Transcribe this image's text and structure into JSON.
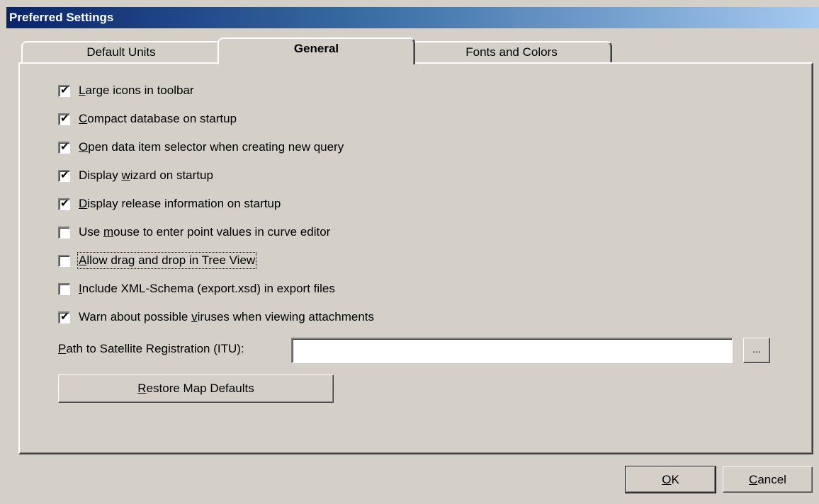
{
  "window": {
    "title": "Preferred Settings"
  },
  "tabs": [
    {
      "label": "Default Units",
      "active": false
    },
    {
      "label": "General",
      "active": true
    },
    {
      "label": "Fonts and Colors",
      "active": false
    }
  ],
  "options": [
    {
      "pre": "",
      "key": "L",
      "post": "arge icons in toolbar",
      "checked": true
    },
    {
      "pre": "",
      "key": "C",
      "post": "ompact database on startup",
      "checked": true
    },
    {
      "pre": "",
      "key": "O",
      "post": "pen data item selector when creating new query",
      "checked": true
    },
    {
      "pre": "Display ",
      "key": "w",
      "post": "izard on startup",
      "checked": true
    },
    {
      "pre": "",
      "key": "D",
      "post": "isplay release information on startup",
      "checked": true
    },
    {
      "pre": "Use ",
      "key": "m",
      "post": "ouse to enter point values in curve editor",
      "checked": false
    },
    {
      "pre": "",
      "key": "A",
      "post": "llow drag and drop in Tree View",
      "checked": false
    },
    {
      "pre": "",
      "key": "I",
      "post": "nclude XML-Schema (export.xsd) in export files",
      "checked": false
    },
    {
      "pre": "Warn about possible ",
      "key": "v",
      "post": "iruses when viewing attachments",
      "checked": true
    }
  ],
  "check_mark": "✔",
  "path": {
    "label_key": "P",
    "label_rest": "ath to Satellite Registration (ITU):",
    "value": "",
    "browse_label": "..."
  },
  "restore": {
    "key": "R",
    "rest": "estore Map Defaults"
  },
  "footer": {
    "ok_key": "O",
    "ok_rest": "K",
    "cancel_key": "C",
    "cancel_rest": "ancel"
  }
}
